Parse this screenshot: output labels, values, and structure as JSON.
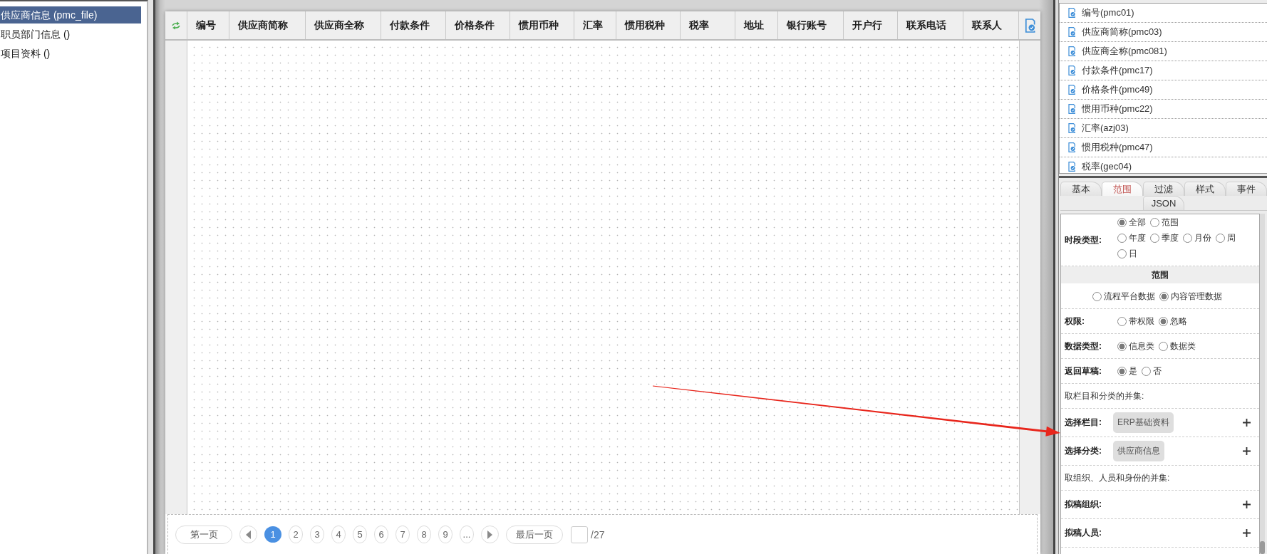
{
  "sidebar": {
    "items": [
      {
        "label": "供应商信息 (pmc_file)",
        "selected": true
      },
      {
        "label": "职员部门信息 ()",
        "selected": false
      },
      {
        "label": "项目资料 ()",
        "selected": false
      }
    ]
  },
  "table": {
    "columns": [
      "编号",
      "供应商简称",
      "供应商全称",
      "付款条件",
      "价格条件",
      "惯用币种",
      "汇率",
      "惯用税种",
      "税率",
      "地址",
      "银行账号",
      "开户行",
      "联系电话",
      "联系人"
    ]
  },
  "pagination": {
    "first": "第一页",
    "pages": [
      {
        "label": "1",
        "selected": true
      },
      {
        "label": "2",
        "selected": false
      },
      {
        "label": "3",
        "selected": false
      },
      {
        "label": "4",
        "selected": false
      },
      {
        "label": "5",
        "selected": false
      },
      {
        "label": "6",
        "selected": false
      },
      {
        "label": "7",
        "selected": false
      },
      {
        "label": "8",
        "selected": false
      },
      {
        "label": "9",
        "selected": false
      }
    ],
    "more": "...",
    "last": "最后一页",
    "page_total": "/27"
  },
  "field_list": {
    "items": [
      "编号(pmc01)",
      "供应商简称(pmc03)",
      "供应商全称(pmc081)",
      "付款条件(pmc17)",
      "价格条件(pmc49)",
      "惯用币种(pmc22)",
      "汇率(azj03)",
      "惯用税种(pmc47)",
      "税率(gec04)"
    ]
  },
  "property_tabs": [
    {
      "label": "基本",
      "selected": false
    },
    {
      "label": "范围",
      "selected": true
    },
    {
      "label": "过滤",
      "selected": false
    },
    {
      "label": "样式",
      "selected": false
    },
    {
      "label": "事件",
      "selected": false
    },
    {
      "label": "JSON",
      "selected": false
    }
  ],
  "form": {
    "rows": [
      {
        "kind": "radio",
        "label": "时段类型:",
        "groups": [
          [
            {
              "label": "全部",
              "selected": true
            },
            {
              "label": "范围",
              "selected": false
            }
          ],
          [
            {
              "label": "年度",
              "selected": false
            },
            {
              "label": "季度",
              "selected": false
            },
            {
              "label": "月份",
              "selected": false
            },
            {
              "label": "周",
              "selected": false
            },
            {
              "label": "日",
              "selected": false
            }
          ]
        ]
      },
      {
        "kind": "section",
        "title": "范围"
      },
      {
        "kind": "radio",
        "groups": [
          [
            {
              "label": "流程平台数据",
              "selected": false
            },
            {
              "label": "内容管理数据",
              "selected": true
            }
          ]
        ]
      },
      {
        "kind": "radio",
        "label": "权限:",
        "groups": [
          [
            {
              "label": "带权限",
              "selected": false
            },
            {
              "label": "忽略",
              "selected": true
            }
          ]
        ]
      },
      {
        "kind": "radio",
        "label": "数据类型:",
        "groups": [
          [
            {
              "label": "信息类",
              "selected": true
            },
            {
              "label": "数据类",
              "selected": false
            }
          ]
        ]
      },
      {
        "kind": "radio",
        "label": "返回草稿:",
        "groups": [
          [
            {
              "label": "是",
              "selected": true
            },
            {
              "label": "否",
              "selected": false
            }
          ]
        ]
      },
      {
        "kind": "note",
        "text": "取栏目和分类的并集:"
      },
      {
        "kind": "picker",
        "label": "选择栏目:",
        "chips": [
          "ERP基础资料"
        ]
      },
      {
        "kind": "picker",
        "label": "选择分类:",
        "chips": [
          "供应商信息"
        ]
      },
      {
        "kind": "note",
        "text": "取组织、人员和身份的并集:"
      },
      {
        "kind": "picker",
        "label": "拟稿组织:"
      },
      {
        "kind": "picker",
        "label": "拟稿人员:"
      }
    ]
  }
}
